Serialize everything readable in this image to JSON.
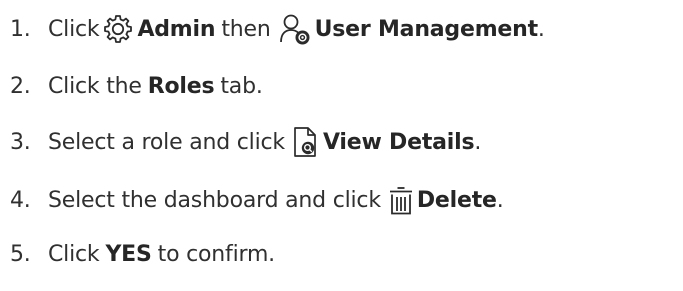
{
  "steps": [
    {
      "number": "1.",
      "parts": {
        "a": "Click",
        "icon1": "gear-icon",
        "b": "Admin",
        "c": "then",
        "icon2": "user-settings-icon",
        "d": "User Management",
        "e": "."
      }
    },
    {
      "number": "2.",
      "parts": {
        "a": "Click the",
        "b": "Roles",
        "c": "tab."
      }
    },
    {
      "number": "3.",
      "parts": {
        "a": "Select a role and click",
        "icon1": "view-details-icon",
        "b": "View Details",
        "c": "."
      }
    },
    {
      "number": "4.",
      "parts": {
        "a": "Select the dashboard and click",
        "icon1": "trash-icon",
        "b": "Delete",
        "c": "."
      }
    },
    {
      "number": "5.",
      "parts": {
        "a": "Click",
        "b": "YES",
        "c": "to confirm."
      }
    }
  ]
}
